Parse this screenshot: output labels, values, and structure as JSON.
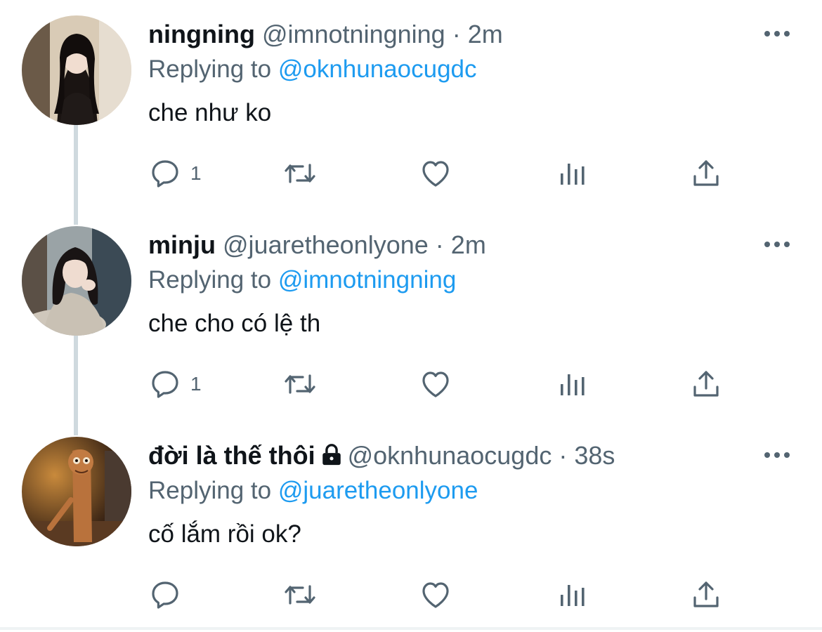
{
  "tweets": [
    {
      "display_name": "ningning",
      "handle": "@imnotningning",
      "separator": "·",
      "time": "2m",
      "replying_prefix": "Replying to ",
      "replying_to": "@oknhunaocugdc",
      "text": "che như ko",
      "reply_count": "1",
      "avatar_icon": "avatar-photo",
      "locked": false
    },
    {
      "display_name": "minju",
      "handle": "@juaretheonlyone",
      "separator": "·",
      "time": "2m",
      "replying_prefix": "Replying to ",
      "replying_to": "@imnotningning",
      "text": "che cho có lệ th",
      "reply_count": "1",
      "avatar_icon": "avatar-photo",
      "locked": false
    },
    {
      "display_name": "đời là thế thôi",
      "handle": "@oknhunaocugdc",
      "separator": "·",
      "time": "38s",
      "replying_prefix": "Replying to ",
      "replying_to": "@juaretheonlyone",
      "text": "cố lắm rồi ok?",
      "reply_count": "",
      "avatar_icon": "avatar-photo",
      "locked": true
    }
  ],
  "icons": {
    "reply": "reply-icon",
    "retweet": "retweet-icon",
    "like": "heart-icon",
    "views": "views-icon",
    "share": "share-icon",
    "more": "more-icon",
    "lock": "lock-icon"
  },
  "colors": {
    "text": "#0f1419",
    "secondary": "#536471",
    "link": "#1d9bf0",
    "thread_line": "#cfd9de"
  }
}
